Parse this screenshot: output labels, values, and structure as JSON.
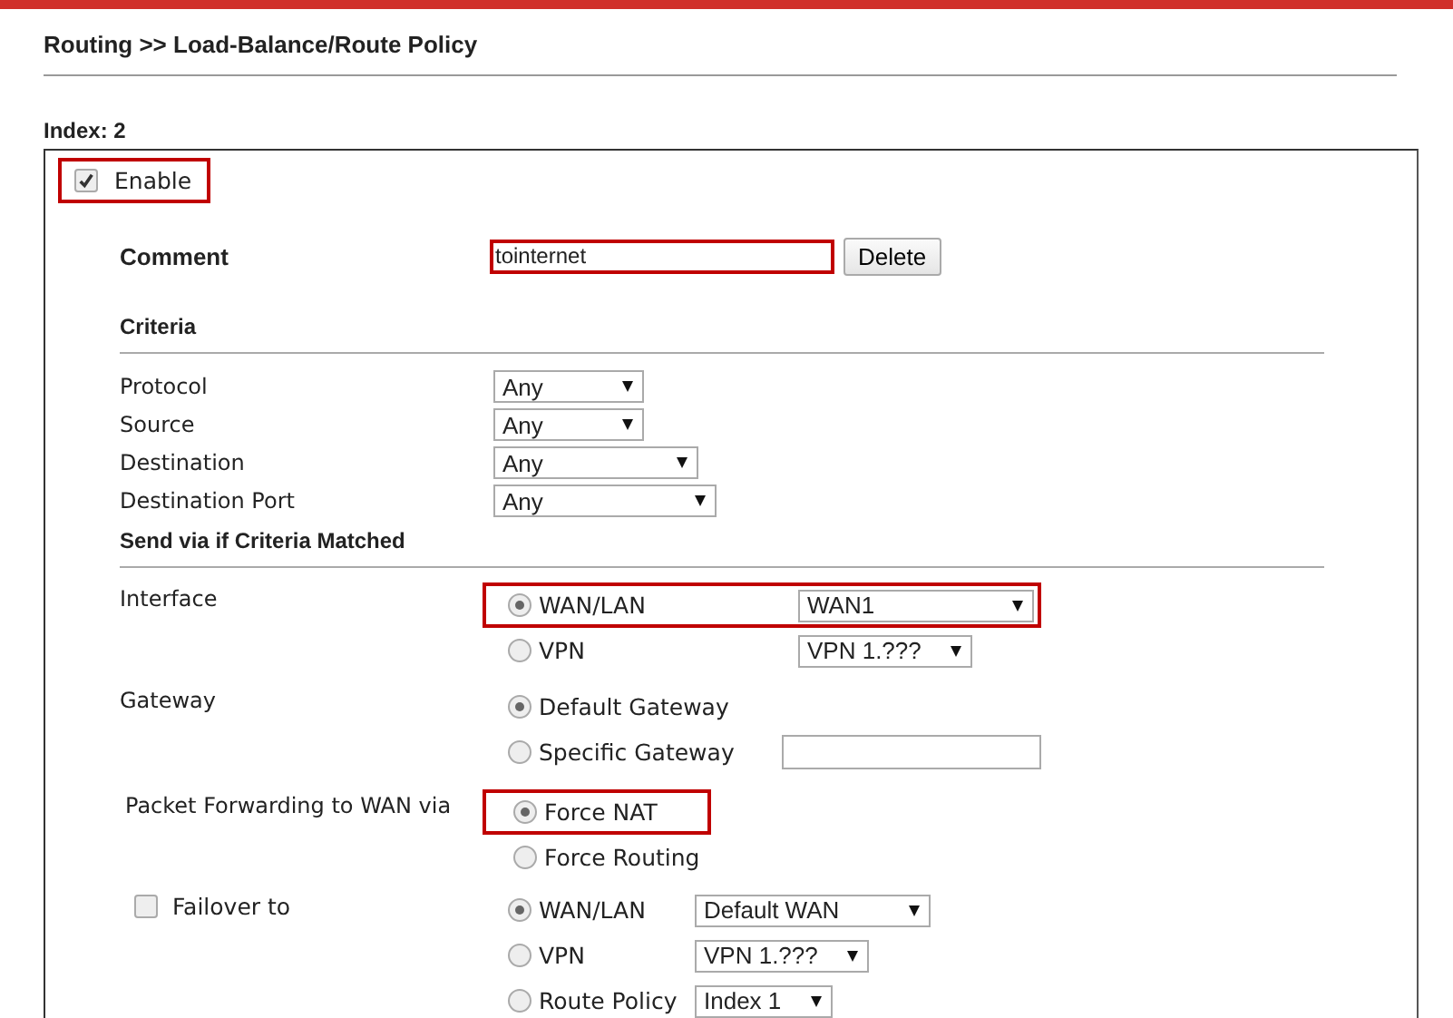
{
  "page_title": "Routing >> Load-Balance/Route Policy",
  "index_label": "Index: 2",
  "enable": {
    "label": "Enable",
    "checked": true,
    "highlighted": true
  },
  "comment": {
    "label": "Comment",
    "value": "tointernet",
    "highlighted": true,
    "button": "Delete"
  },
  "criteria": {
    "title": "Criteria",
    "fields": [
      {
        "label": "Protocol",
        "value": "Any"
      },
      {
        "label": "Source",
        "value": "Any"
      },
      {
        "label": "Destination",
        "value": "Any"
      },
      {
        "label": "Destination Port",
        "value": "Any"
      }
    ]
  },
  "send_via": {
    "title": "Send via if Criteria Matched",
    "groups": [
      {
        "label": "Interface",
        "options": [
          {
            "label": "WAN/LAN",
            "selected": true,
            "highlighted": true,
            "kind": "select",
            "value": "WAN1"
          },
          {
            "label": "VPN",
            "selected": false,
            "highlighted": false,
            "kind": "select",
            "value": "VPN 1.???"
          }
        ]
      },
      {
        "label": "Gateway",
        "options": [
          {
            "label": "Default Gateway",
            "selected": true,
            "highlighted": false,
            "kind": "plain"
          },
          {
            "label": "Specific Gateway",
            "selected": false,
            "highlighted": false,
            "kind": "field"
          }
        ]
      },
      {
        "label": "Packet Forwarding to WAN via",
        "options": [
          {
            "label": "Force NAT",
            "selected": true,
            "highlighted": true,
            "kind": "plain"
          },
          {
            "label": "Force Routing",
            "selected": false,
            "highlighted": false,
            "kind": "plain"
          }
        ]
      },
      {
        "label": "Failover to",
        "checkbox": {
          "checked": false
        },
        "options": [
          {
            "label": "WAN/LAN",
            "selected": true,
            "highlighted": false,
            "kind": "select",
            "value": "Default WAN"
          },
          {
            "label": "VPN",
            "selected": false,
            "highlighted": false,
            "kind": "select",
            "value": "VPN 1.???"
          },
          {
            "label": "Route Policy",
            "selected": false,
            "highlighted": false,
            "kind": "select",
            "value": "Index 1"
          }
        ]
      }
    ]
  }
}
